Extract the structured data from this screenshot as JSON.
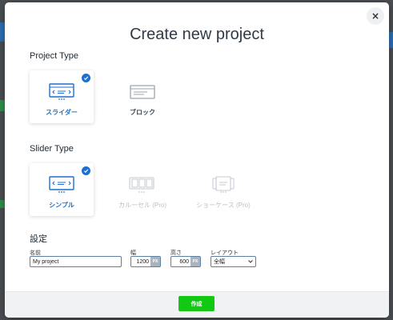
{
  "dialog": {
    "title": "Create new project",
    "close_symbol": "×"
  },
  "project_type": {
    "heading": "Project Type",
    "options": [
      {
        "label": "スライダー",
        "icon": "slider-icon",
        "selected": true
      },
      {
        "label": "ブロック",
        "icon": "block-icon",
        "selected": false
      }
    ]
  },
  "slider_type": {
    "heading": "Slider Type",
    "options": [
      {
        "label": "シンプル",
        "icon": "simple-slider-icon",
        "selected": true,
        "disabled": false
      },
      {
        "label": "カルーセル (Pro)",
        "icon": "carousel-icon",
        "selected": false,
        "disabled": true
      },
      {
        "label": "ショーケース (Pro)",
        "icon": "showcase-icon",
        "selected": false,
        "disabled": true
      }
    ]
  },
  "settings": {
    "heading": "設定",
    "name_label": "名前",
    "name_value": "My project",
    "width_label": "幅",
    "width_value": "1200",
    "height_label": "高さ",
    "height_value": "600",
    "unit": "PX",
    "layout_label": "レイアウト",
    "layout_value": "全幅"
  },
  "footer": {
    "create_label": "作成"
  },
  "colors": {
    "accent": "#1d6fd1",
    "create_button": "#12c812"
  }
}
